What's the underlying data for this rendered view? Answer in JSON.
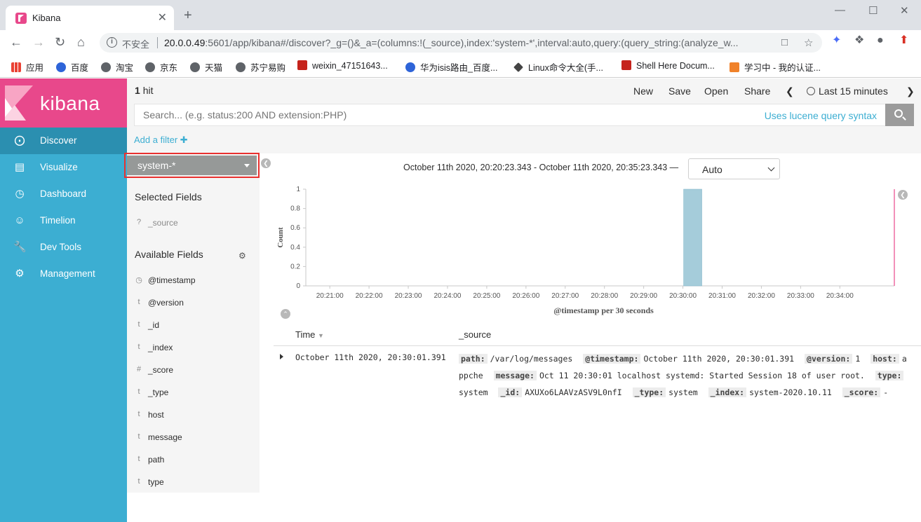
{
  "browser": {
    "tab_title": "Kibana",
    "tab_close": "✕",
    "new_tab": "+",
    "insecure_label": "不安全",
    "url_host": "20.0.0.49",
    "url_rest": ":5601/app/kibana#/discover?_g=()&_a=(columns:!(_source),index:'system-*',interval:auto,query:(query_string:(analyze_w...",
    "bookmarks": [
      {
        "label": "应用",
        "icon": "apps-grid-icon",
        "color": "#4285f4"
      },
      {
        "label": "百度",
        "icon": "baidu-paw-icon",
        "color": "#2e64d8"
      },
      {
        "label": "淘宝",
        "icon": "globe-icon",
        "color": "#5f6368"
      },
      {
        "label": "京东",
        "icon": "globe-icon",
        "color": "#5f6368"
      },
      {
        "label": "天猫",
        "icon": "globe-icon",
        "color": "#5f6368"
      },
      {
        "label": "苏宁易购",
        "icon": "globe-icon",
        "color": "#5f6368"
      },
      {
        "label": "weixin_47151643...",
        "icon": "csdn-icon",
        "color": "#c5231c"
      },
      {
        "label": "华为isis路由_百度...",
        "icon": "baidu-paw-icon",
        "color": "#2e64d8"
      },
      {
        "label": "Linux命令大全(手...",
        "icon": "linux-icon",
        "color": "#444444"
      },
      {
        "label": "Shell Here Docum...",
        "icon": "csdn-icon",
        "color": "#c5231c"
      },
      {
        "label": "学习中 - 我的认证...",
        "icon": "study-icon",
        "color": "#f0822a"
      }
    ]
  },
  "kibana": {
    "logo_text": "kibana",
    "nav": [
      {
        "label": "Discover",
        "icon": "compass-icon",
        "active": true
      },
      {
        "label": "Visualize",
        "icon": "bar-chart-icon",
        "active": false
      },
      {
        "label": "Dashboard",
        "icon": "dashboard-icon",
        "active": false
      },
      {
        "label": "Timelion",
        "icon": "timelion-icon",
        "active": false
      },
      {
        "label": "Dev Tools",
        "icon": "wrench-icon",
        "active": false
      },
      {
        "label": "Management",
        "icon": "gear-icon",
        "active": false
      }
    ],
    "hits_count": "1",
    "hits_label": "hit",
    "top_actions": {
      "new": "New",
      "save": "Save",
      "open": "Open",
      "share": "Share"
    },
    "time_picker_label": "Last 15 minutes",
    "search_placeholder": "Search... (e.g. status:200 AND extension:PHP)",
    "lucene_link": "Uses lucene query syntax",
    "add_filter": "Add a filter ✚",
    "index_pattern": "system-*",
    "selected_fields_title": "Selected Fields",
    "selected_fields": [
      {
        "type": "?",
        "name": "_source"
      }
    ],
    "available_fields_title": "Available Fields",
    "available_fields": [
      {
        "type": "◷",
        "name": "@timestamp"
      },
      {
        "type": "t",
        "name": "@version"
      },
      {
        "type": "t",
        "name": "_id"
      },
      {
        "type": "t",
        "name": "_index"
      },
      {
        "type": "#",
        "name": "_score"
      },
      {
        "type": "t",
        "name": "_type"
      },
      {
        "type": "t",
        "name": "host"
      },
      {
        "type": "t",
        "name": "message"
      },
      {
        "type": "t",
        "name": "path"
      },
      {
        "type": "t",
        "name": "type"
      }
    ],
    "time_range_text": "October 11th 2020, 20:20:23.343 - October 11th 2020, 20:35:23.343 —",
    "interval_selected": "Auto",
    "table": {
      "col_time": "Time",
      "col_source": "_source",
      "rows": [
        {
          "time": "October 11th 2020, 20:30:01.391",
          "source": [
            {
              "k": "path:",
              "v": "/var/log/messages"
            },
            {
              "k": "@timestamp:",
              "v": "October 11th 2020, 20:30:01.391"
            },
            {
              "k": "@version:",
              "v": "1"
            },
            {
              "k": "host:",
              "v": "appche"
            },
            {
              "k": "message:",
              "v": "Oct 11 20:30:01 localhost systemd: Started Session 18 of user root."
            },
            {
              "k": "type:",
              "v": "system"
            },
            {
              "k": "_id:",
              "v": "AXUXo6LAAVzASV9L0nfI"
            },
            {
              "k": "_type:",
              "v": "system"
            },
            {
              "k": "_index:",
              "v": "system-2020.10.11"
            },
            {
              "k": "_score:",
              "v": "-"
            }
          ]
        }
      ]
    }
  },
  "chart_data": {
    "type": "bar",
    "title": "",
    "xlabel": "@timestamp per 30 seconds",
    "ylabel": "Count",
    "x_ticks": [
      "20:21:00",
      "20:22:00",
      "20:23:00",
      "20:24:00",
      "20:25:00",
      "20:26:00",
      "20:27:00",
      "20:28:00",
      "20:29:00",
      "20:30:00",
      "20:31:00",
      "20:32:00",
      "20:33:00",
      "20:34:00"
    ],
    "y_ticks": [
      "0",
      "0.2",
      "0.4",
      "0.6",
      "0.8",
      "1"
    ],
    "ylim": [
      0,
      1
    ],
    "x_range": [
      "20:20:23.343",
      "20:35:23.343"
    ],
    "bars": [
      {
        "start": "20:30:00",
        "end": "20:30:30",
        "value": 1
      }
    ],
    "bar_color": "#a5ccda",
    "now_marker": "20:35:23.343",
    "now_marker_color": "#e8488b"
  }
}
